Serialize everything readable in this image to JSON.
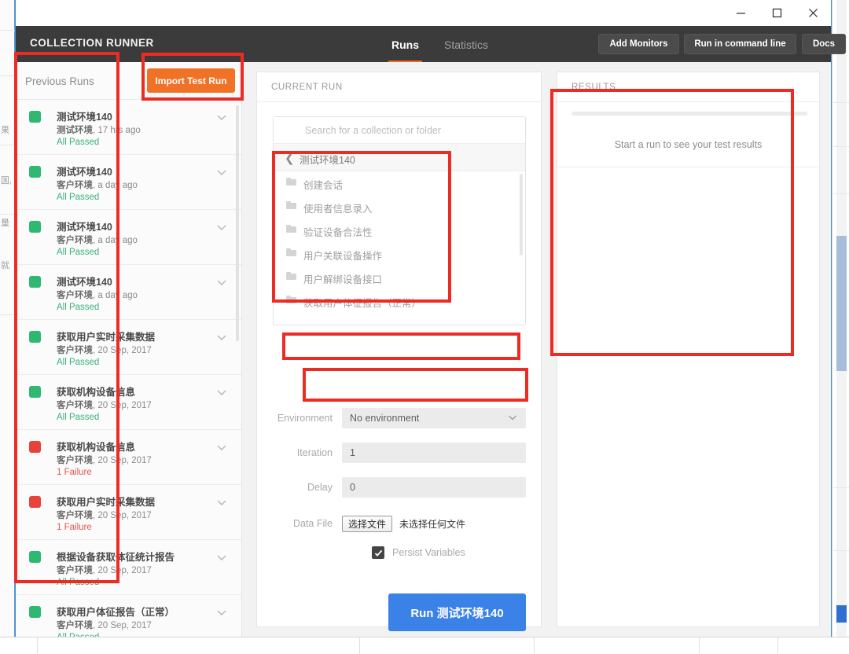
{
  "window": {
    "buttons": [
      {
        "name": "minimize",
        "glyph": "minimize-icon"
      },
      {
        "name": "maximize",
        "glyph": "maximize-icon"
      },
      {
        "name": "close",
        "glyph": "close-icon"
      }
    ]
  },
  "header": {
    "brand": "COLLECTION RUNNER",
    "tabs": [
      {
        "label": "Runs",
        "active": true
      },
      {
        "label": "Statistics",
        "active": false
      }
    ],
    "buttons": [
      {
        "label": "Add Monitors"
      },
      {
        "label": "Run in command line"
      },
      {
        "label": "Docs"
      }
    ],
    "accent_color": "#f26b21",
    "background_color": "#3b3b3b"
  },
  "sidebar": {
    "title": "Previous Runs",
    "import_button": "Import Test Run",
    "import_button_color": "#f07227",
    "pass_color": "#2eb872",
    "fail_color": "#e8433a",
    "pass_text_color": "#3ab07a",
    "fail_text_color": "#e2584e",
    "runs": [
      {
        "name": "测试环境140",
        "environment": "测试环境",
        "time": "17 hrs ago",
        "status": "All Passed",
        "state": "pass"
      },
      {
        "name": "测试环境140",
        "environment": "客户环境",
        "time": "a day ago",
        "status": "All Passed",
        "state": "pass"
      },
      {
        "name": "测试环境140",
        "environment": "客户环境",
        "time": "a day ago",
        "status": "All Passed",
        "state": "pass"
      },
      {
        "name": "测试环境140",
        "environment": "客户环境",
        "time": "a day ago",
        "status": "All Passed",
        "state": "pass"
      },
      {
        "name": "获取用户实时采集数据",
        "environment": "客户环境",
        "time": "20 Sep, 2017",
        "status": "All Passed",
        "state": "pass"
      },
      {
        "name": "获取机构设备信息",
        "environment": "客户环境",
        "time": "20 Sep, 2017",
        "status": "All Passed",
        "state": "pass"
      },
      {
        "name": "获取机构设备信息",
        "environment": "客户环境",
        "time": "20 Sep, 2017",
        "status": "1 Failure",
        "state": "fail"
      },
      {
        "name": "获取用户实时采集数据",
        "environment": "客户环境",
        "time": "20 Sep, 2017",
        "status": "1 Failure",
        "state": "fail"
      },
      {
        "name": "根据设备获取体征统计报告",
        "environment": "客户环境",
        "time": "20 Sep, 2017",
        "status": "All Passed",
        "state": "pass"
      },
      {
        "name": "获取用户体征报告（正常）",
        "environment": "客户环境",
        "time": "20 Sep, 2017",
        "status": "All Passed",
        "state": "pass"
      }
    ]
  },
  "current_run": {
    "panel_label": "CURRENT RUN",
    "search_placeholder": "Search for a collection or folder",
    "search_value": "",
    "breadcrumb": "测试环境140",
    "folders": [
      {
        "label": "创建会话"
      },
      {
        "label": "使用者信息录入"
      },
      {
        "label": "验证设备合法性"
      },
      {
        "label": "用户关联设备操作"
      },
      {
        "label": "用户解绑设备接口"
      },
      {
        "label": "获取用户体征报告（正常）"
      }
    ],
    "form": {
      "environment_label": "Environment",
      "environment_value": "No environment",
      "iteration_label": "Iteration",
      "iteration_value": "1",
      "delay_label": "Delay",
      "delay_value": "0",
      "data_file_label": "Data File",
      "data_file_button": "选择文件",
      "data_file_status": "未选择任何文件",
      "persist_label": "Persist Variables",
      "persist_checked": true
    },
    "run_button": "Run 测试环境140",
    "run_button_color": "#3b82e8"
  },
  "results": {
    "panel_label": "RESULTS",
    "empty_message": "Start a run to see your test results"
  },
  "annotations": {
    "color": "#ee2b22",
    "boxes": [
      {
        "target": "previous-runs-list"
      },
      {
        "target": "import-test-run-button"
      },
      {
        "target": "collection-folder-list"
      },
      {
        "target": "environment-row"
      },
      {
        "target": "iteration-row"
      },
      {
        "target": "results-panel"
      }
    ]
  },
  "background": {
    "left_glyphs": [
      "果",
      "国,",
      "量",
      "就"
    ]
  }
}
